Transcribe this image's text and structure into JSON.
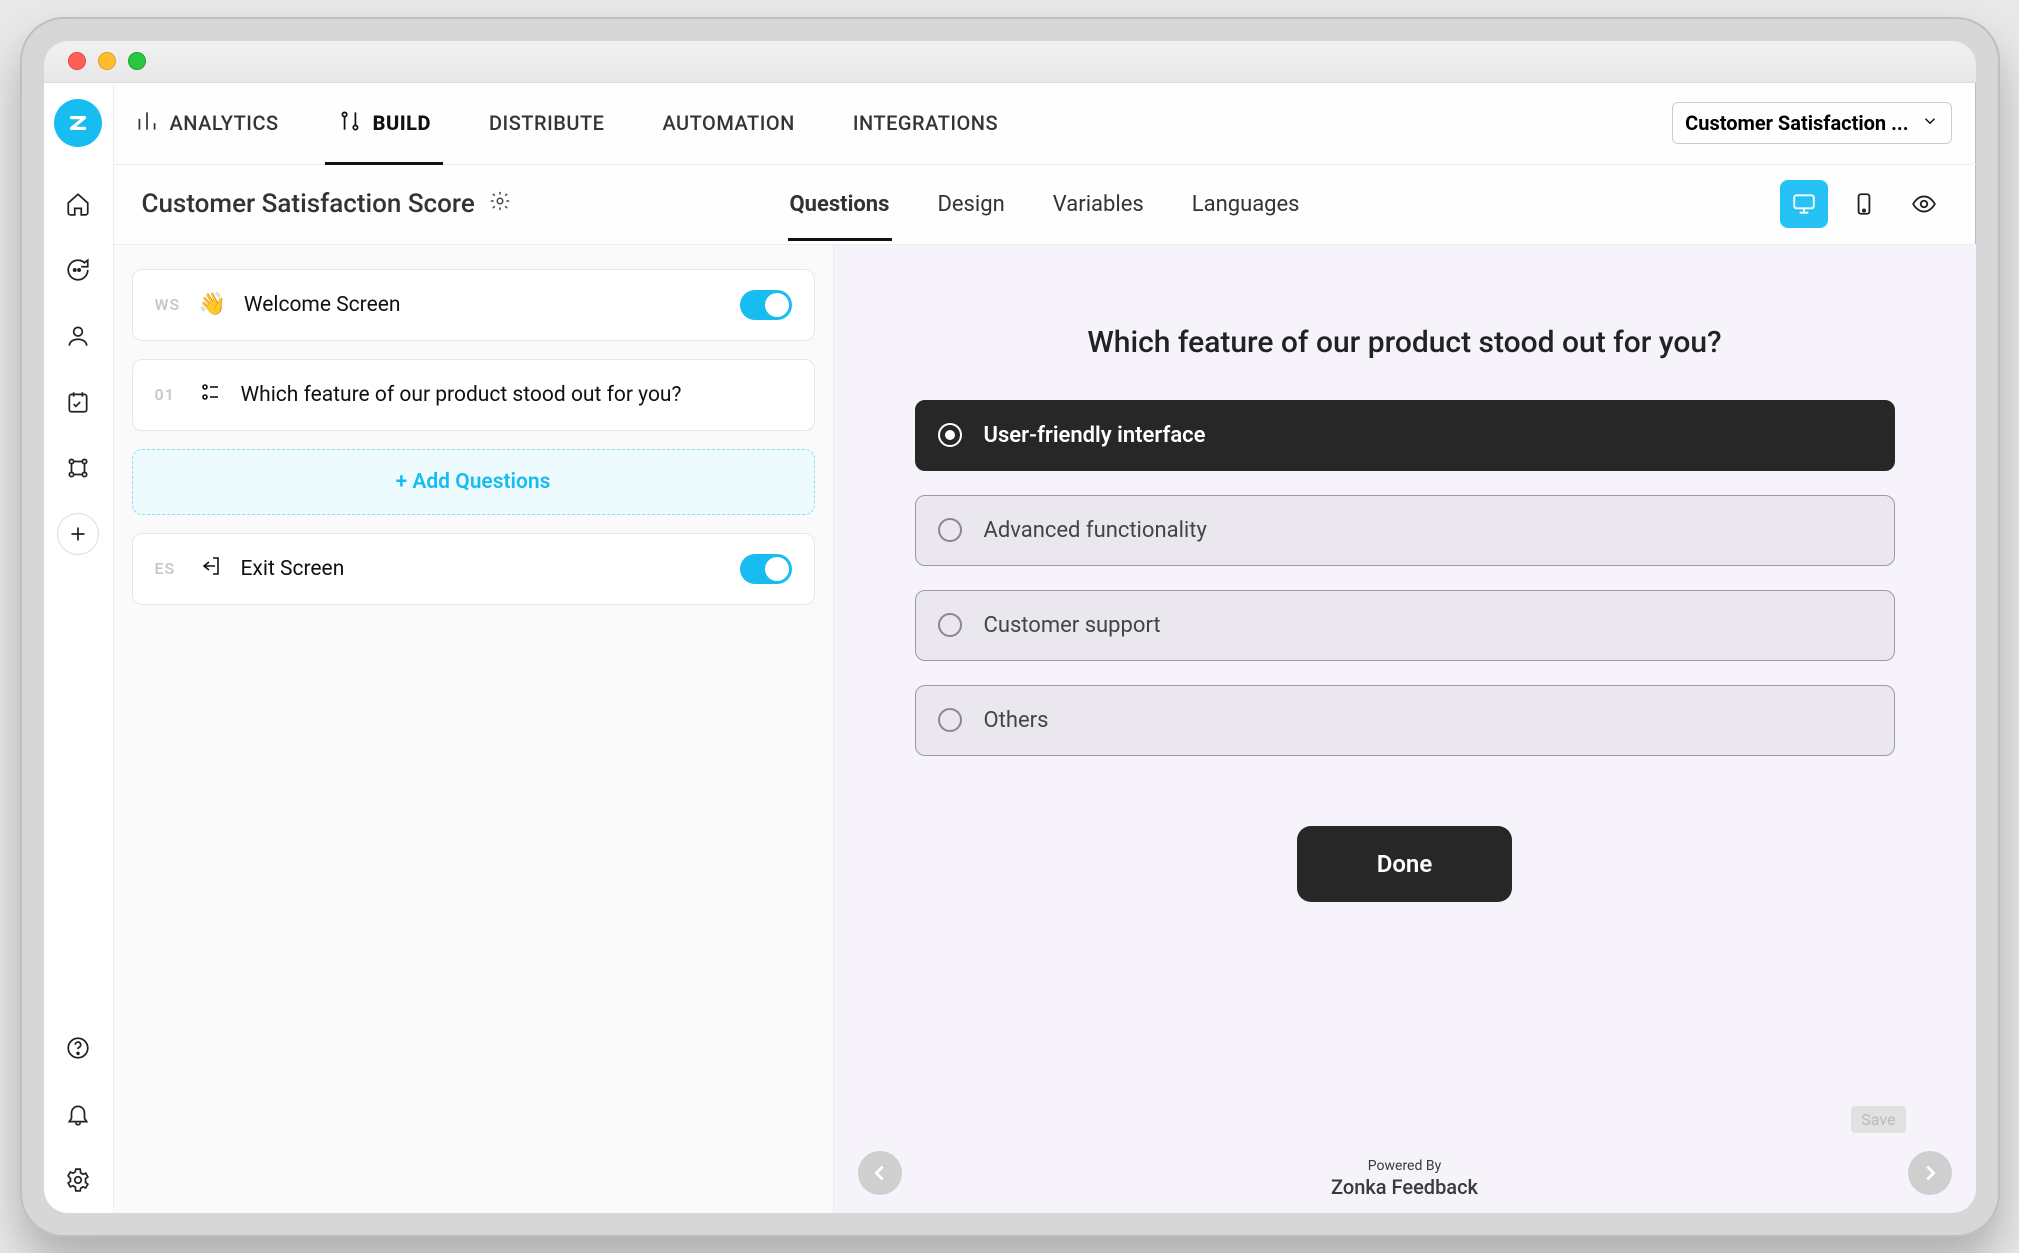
{
  "window": {
    "title": "Customer Satisfaction ..."
  },
  "topnav": {
    "items": [
      {
        "label": "ANALYTICS",
        "icon": "analytics-icon"
      },
      {
        "label": "BUILD",
        "icon": "build-icon",
        "active": true
      },
      {
        "label": "DISTRIBUTE"
      },
      {
        "label": "AUTOMATION"
      },
      {
        "label": "INTEGRATIONS"
      }
    ],
    "selector_label": "Customer Satisfaction ..."
  },
  "survey": {
    "title": "Customer Satisfaction Score"
  },
  "subtabs": [
    {
      "label": "Questions",
      "active": true
    },
    {
      "label": "Design"
    },
    {
      "label": "Variables"
    },
    {
      "label": "Languages"
    }
  ],
  "view_controls": {
    "desktop": true,
    "mobile": false,
    "preview": false
  },
  "builder": {
    "welcome": {
      "idx": "WS",
      "label": "Welcome Screen",
      "enabled": true
    },
    "questions": [
      {
        "idx": "01",
        "text": "Which feature of our product stood out for you?"
      }
    ],
    "add_label": "+ Add Questions",
    "exit": {
      "idx": "ES",
      "label": "Exit Screen",
      "enabled": true
    }
  },
  "preview": {
    "question": "Which feature of our product stood out for you?",
    "options": [
      {
        "label": "User-friendly interface",
        "selected": true
      },
      {
        "label": "Advanced functionality",
        "selected": false
      },
      {
        "label": "Customer support",
        "selected": false
      },
      {
        "label": "Others",
        "selected": false
      }
    ],
    "done_label": "Done",
    "save_chip": "Save",
    "powered_top": "Powered By",
    "powered_brand": "Zonka Feedback"
  },
  "colors": {
    "accent": "#17bdf0",
    "dark": "#272727",
    "preview_bg": "#f6f3fb"
  }
}
